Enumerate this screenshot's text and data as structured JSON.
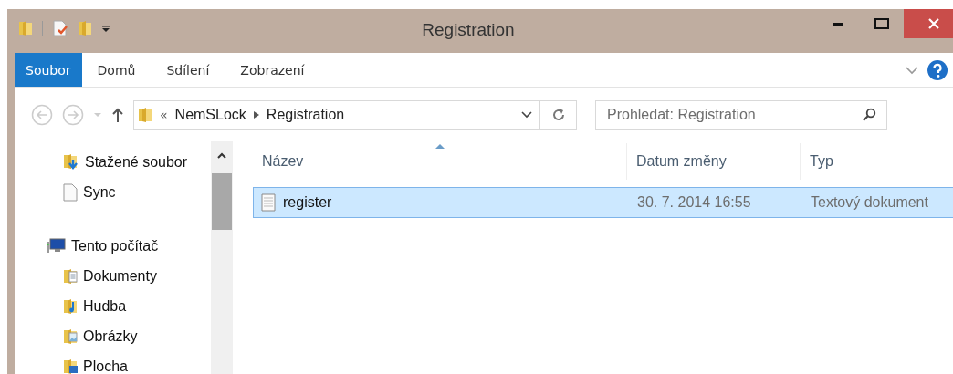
{
  "window": {
    "title": "Registration"
  },
  "ribbon_tabs": [
    {
      "label": "Soubor",
      "selected": true
    },
    {
      "label": "Domů",
      "selected": false
    },
    {
      "label": "Sdílení",
      "selected": false
    },
    {
      "label": "Zobrazení",
      "selected": false
    }
  ],
  "address": {
    "prefix": "«",
    "path": [
      {
        "label": "NemSLock"
      },
      {
        "label": "Registration"
      }
    ]
  },
  "search": {
    "placeholder": "Prohledat: Registration"
  },
  "sidebar": {
    "favorites": [
      {
        "label": "Stažené soubor",
        "kind": "download"
      },
      {
        "label": "Sync",
        "kind": "file"
      }
    ],
    "this_pc": {
      "label": "Tento počítač",
      "kind": "computer",
      "children": [
        {
          "label": "Dokumenty",
          "kind": "documents"
        },
        {
          "label": "Hudba",
          "kind": "music"
        },
        {
          "label": "Obrázky",
          "kind": "pictures"
        },
        {
          "label": "Plocha",
          "kind": "desktop"
        }
      ]
    }
  },
  "table": {
    "columns": [
      {
        "label": "Název",
        "sorted": true
      },
      {
        "label": "Datum změny",
        "sorted": false
      },
      {
        "label": "Typ",
        "sorted": false
      }
    ],
    "rows": [
      {
        "cells": [
          "register",
          "30. 7. 2014 16:55",
          "Textový dokument"
        ],
        "selected": true
      }
    ]
  }
}
